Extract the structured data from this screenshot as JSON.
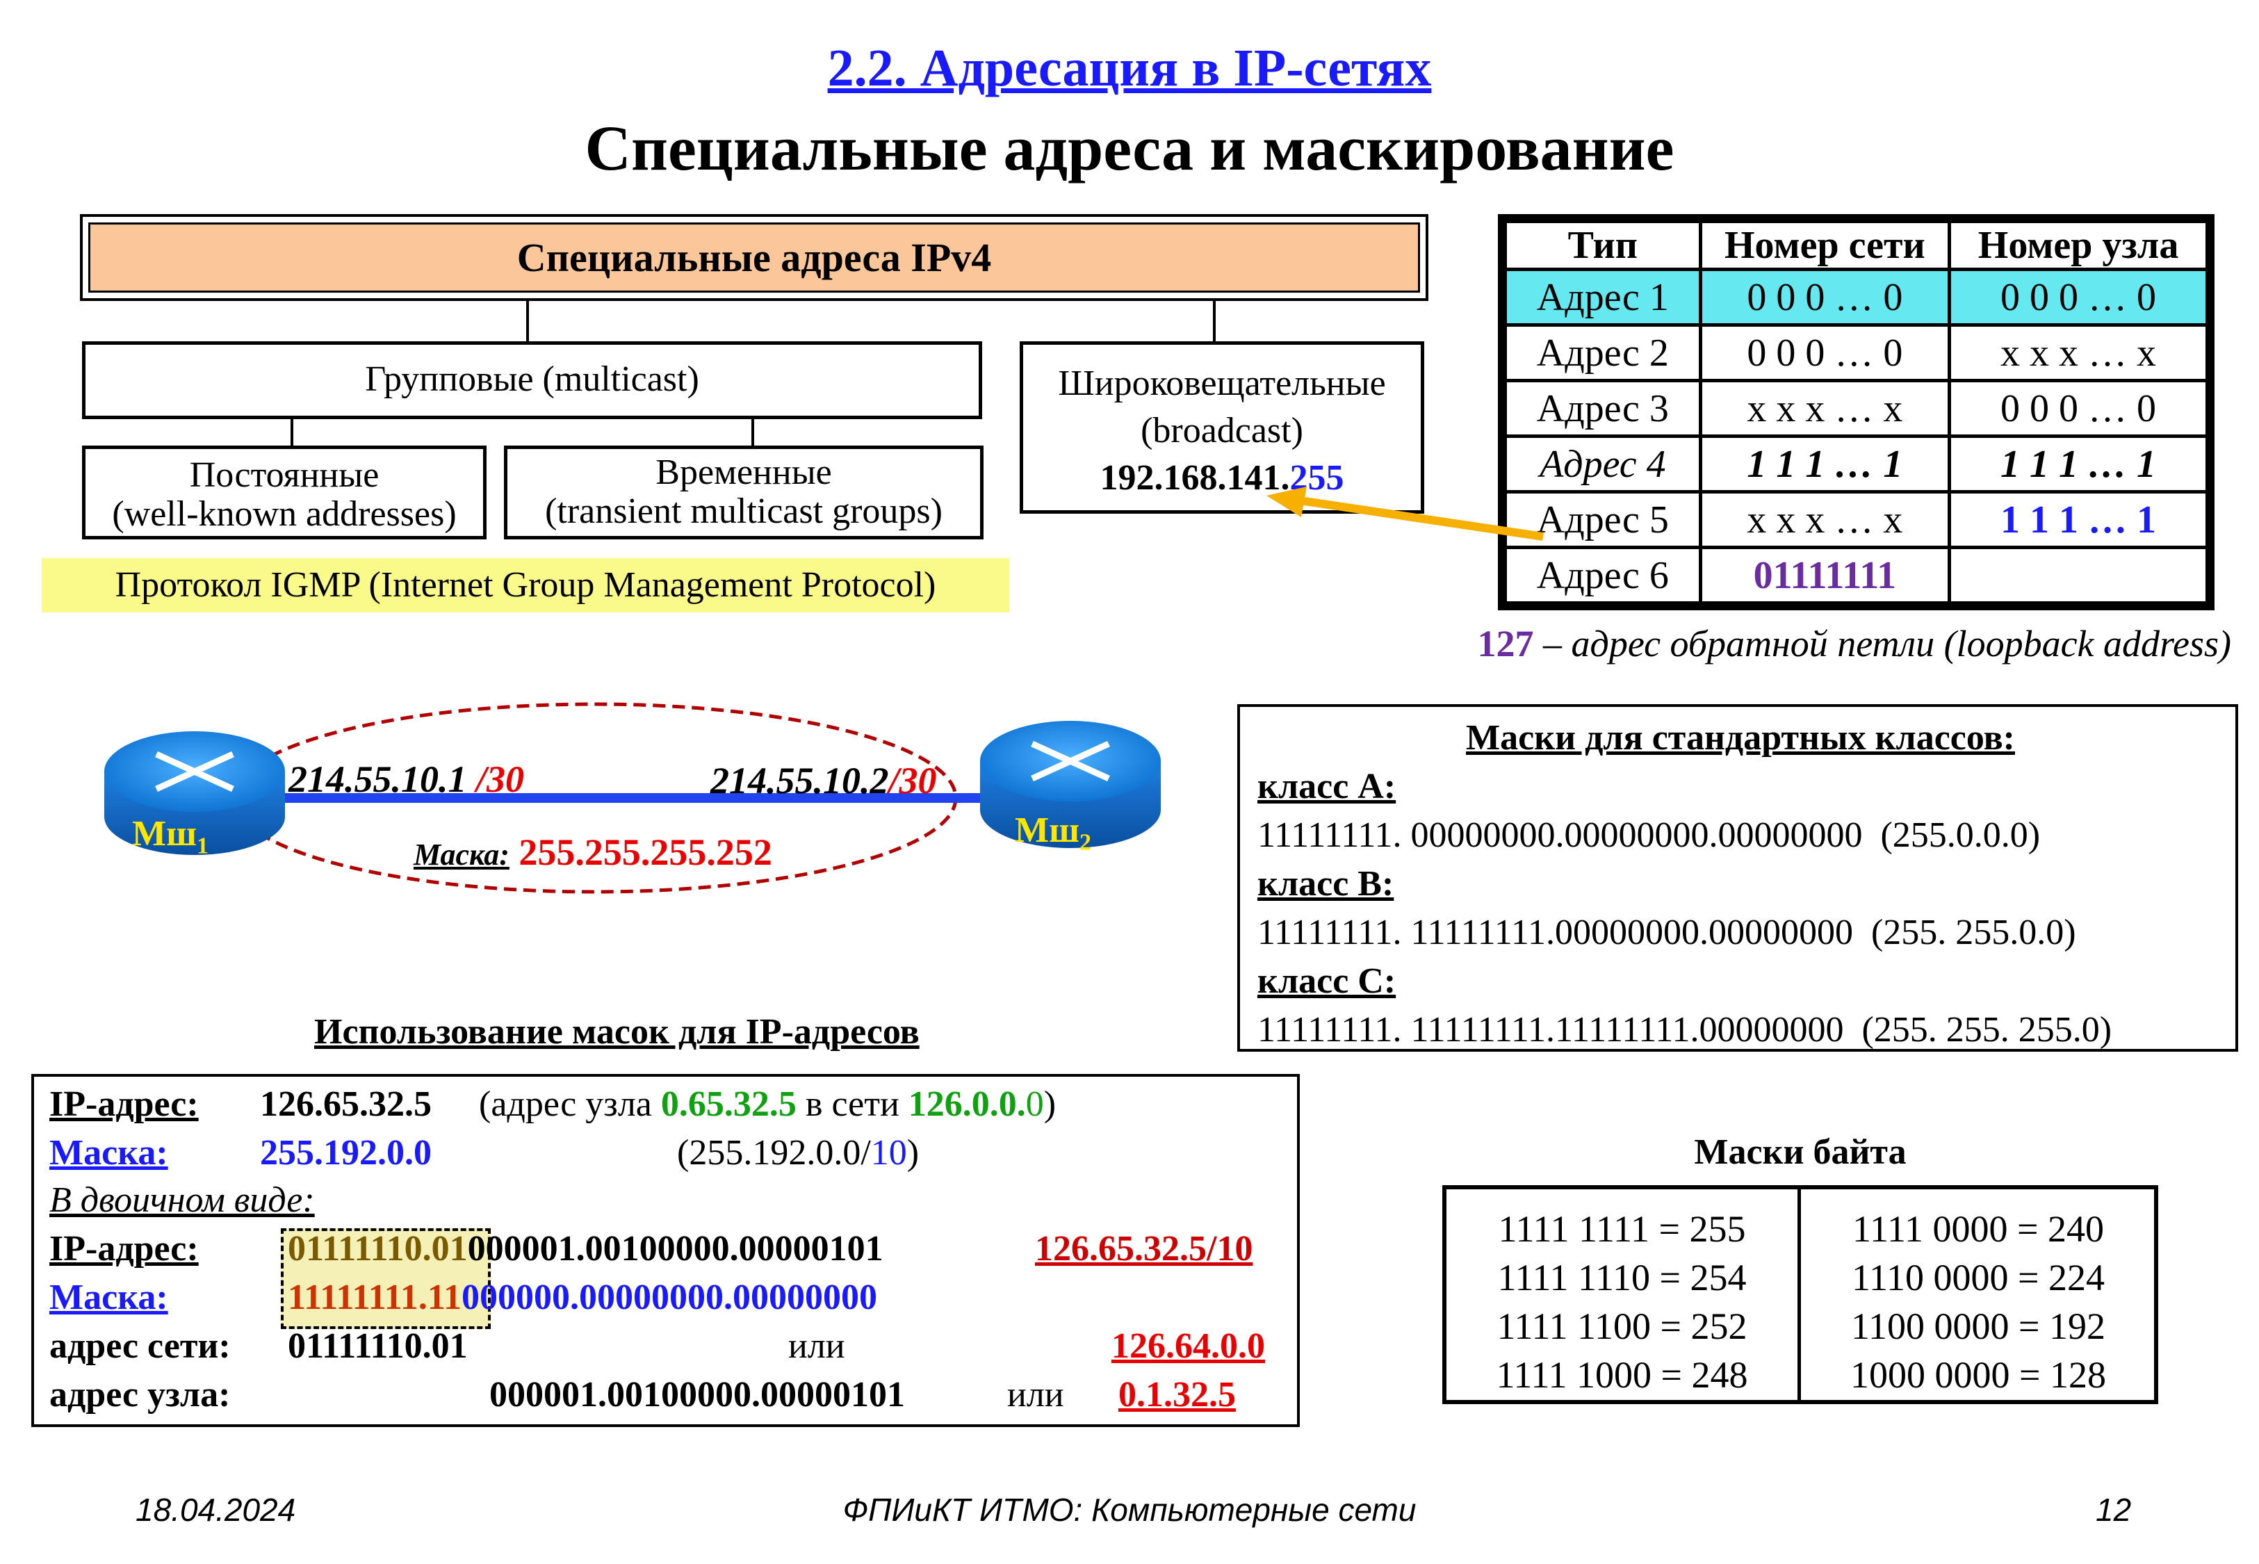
{
  "slide": {
    "section_title": "2.2. Адресация в IP-сетях",
    "main_title": "Специальные адреса и маскирование"
  },
  "tree": {
    "root": "Специальные адреса IPv4",
    "multicast": "Групповые (multicast)",
    "broadcast_line1": "Широковещательные",
    "broadcast_line2": "(broadcast)",
    "broadcast_ip_prefix": "192.168.141.",
    "broadcast_ip_suffix": "255",
    "permanent_line1": "Постоянные",
    "permanent_line2": "(well-known addresses)",
    "transient_line1": "Временные",
    "transient_line2": "(transient multicast groups)",
    "igmp": "Протокол IGMP (Internet Group Management Protocol)"
  },
  "spec_table": {
    "headers": [
      "Тип",
      "Номер сети",
      "Номер узла"
    ],
    "rows": [
      [
        "Адрес 1",
        "0 0 0 … 0",
        "0 0 0 … 0"
      ],
      [
        "Адрес 2",
        "0 0 0 … 0",
        "x x x … x"
      ],
      [
        "Адрес 3",
        "x x x … x",
        "0 0 0 … 0"
      ],
      [
        "Адрес 4",
        "1 1 1 … 1",
        "1 1 1 … 1"
      ],
      [
        "Адрес 5",
        "x x x … x",
        "1 1 1 … 1"
      ],
      [
        "Адрес 6",
        "01111111",
        ""
      ]
    ],
    "loopback_num": "127",
    "loopback_text": " – адрес обратной петли (loopback address)"
  },
  "routers": {
    "left_label": "Мш",
    "left_sub": "1",
    "right_label": "Мш",
    "right_sub": "2",
    "left_ip": "214.55.10.1",
    "left_prefix": "/30",
    "right_ip": "214.55.10.2",
    "right_prefix": "/30",
    "mask_label": "Маска:",
    "mask_value": "255.255.255.252"
  },
  "class_masks": {
    "title": "Маски для стандартных классов:",
    "class_a": "класс А:",
    "class_a_value": "11111111. 00000000.00000000.00000000  (255.0.0.0)",
    "class_b": "класс В:",
    "class_b_value": "11111111. 11111111.00000000.00000000  (255. 255.0.0)",
    "class_c": "класс С:",
    "class_c_value": "11111111. 11111111.11111111.00000000  (255. 255. 255.0)"
  },
  "mask_usage": {
    "title": "Использование масок для IP-адресов",
    "ip_label": "IP-адрес:",
    "ip_value": "126.65.32.5",
    "ip_note_open": "(адрес узла ",
    "ip_note_host": "0.65.32.5",
    "ip_note_mid": " в сети ",
    "ip_note_net": "126.0.0.",
    "ip_note_zero": "0",
    "ip_note_close": ")",
    "mask_label": "Маска:",
    "mask_value": "255.192.0.0",
    "mask_note_open": "(255.192.0.0/",
    "mask_note_prefix": "10",
    "mask_note_close": ")",
    "binary_label": "В двоичном виде:",
    "bin_ip_label": "IP-адрес:",
    "bin_ip_a": "01111110.01",
    "bin_ip_b": "000001.00100000.00000101",
    "bin_ip_result": "126.65.32.5/10",
    "bin_mask_label": "Маска:",
    "bin_mask_a": "11111111.11",
    "bin_mask_b": "000000.00000000.00000000",
    "net_label": "адрес сети:",
    "net_value": "01111110.01",
    "net_or": "или",
    "net_result": "126.64.0.0",
    "host_label": "адрес узла:",
    "host_value": "000001.00100000.00000101",
    "host_or": "или",
    "host_result": "0.1.32.5"
  },
  "byte_masks": {
    "title": "Маски байта",
    "left": [
      "1111 1111 = 255",
      "1111 1110 = 254",
      "1111 1100 = 252",
      "1111 1000 = 248"
    ],
    "right": [
      "1111 0000 = 240",
      "1110 0000 = 224",
      "1100 0000 = 192",
      "1000 0000 = 128"
    ]
  },
  "footer": {
    "date": "18.04.2024",
    "center": "ФПИиКТ ИТМО: Компьютерные сети",
    "page": "12"
  },
  "colors": {
    "link_blue": "#1a1aff",
    "header_orange": "#fbc79a",
    "cyan_row": "#66e8f0",
    "yellow_note": "#fafa8a",
    "red": "#e60000",
    "dark_red": "#cc0000",
    "green": "#11a011",
    "purple": "#6a2da0",
    "arrow_orange": "#f5b000"
  }
}
